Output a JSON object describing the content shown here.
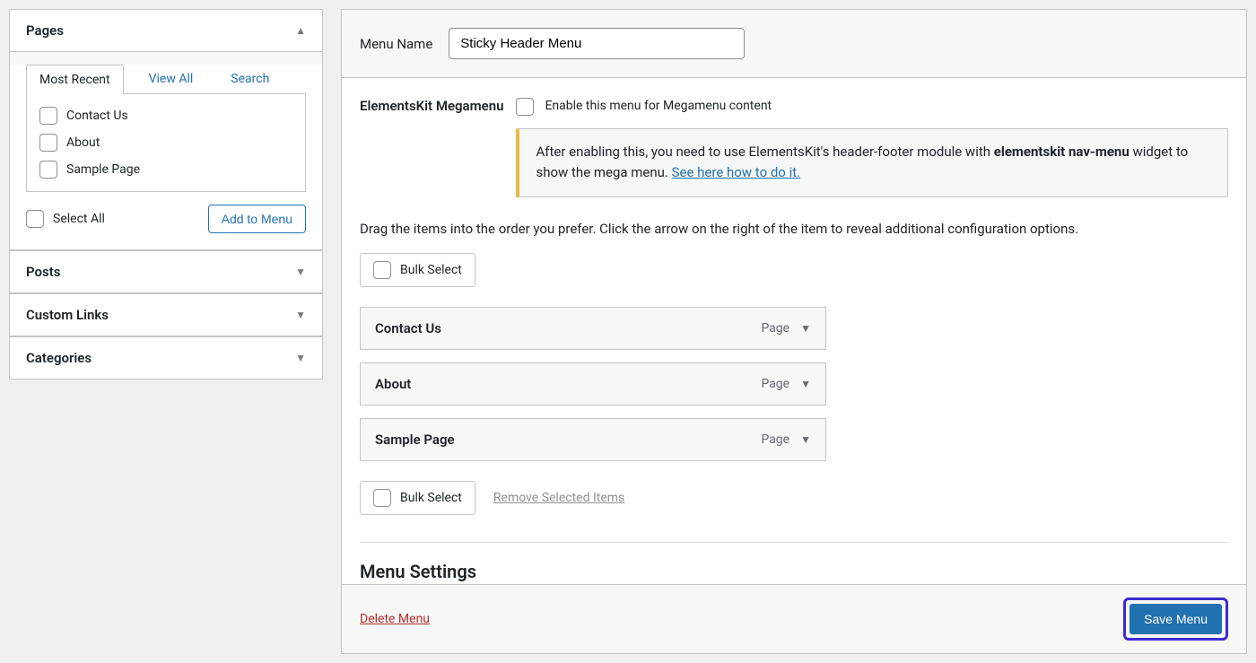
{
  "sidebar": {
    "pages": {
      "title": "Pages",
      "tabs": [
        "Most Recent",
        "View All",
        "Search"
      ],
      "items": [
        "Contact Us",
        "About",
        "Sample Page"
      ],
      "select_all": "Select All",
      "add_to_menu": "Add to Menu"
    },
    "sections": [
      "Posts",
      "Custom Links",
      "Categories"
    ]
  },
  "main": {
    "menu_name_label": "Menu Name",
    "menu_name_value": "Sticky Header Menu",
    "ek_label": "ElementsKit Megamenu",
    "ek_enable": "Enable this menu for Megamenu content",
    "notice_pre": "After enabling this, you need to use ElementsKit's header-footer module with ",
    "notice_bold": "elementskit nav-menu",
    "notice_post": " widget to show the mega menu. ",
    "notice_link": "See here how to do it.",
    "instructions": "Drag the items into the order you prefer. Click the arrow on the right of the item to reveal additional configuration options.",
    "bulk_select": "Bulk Select",
    "menu_items": [
      {
        "title": "Contact Us",
        "type": "Page"
      },
      {
        "title": "About",
        "type": "Page"
      },
      {
        "title": "Sample Page",
        "type": "Page"
      }
    ],
    "remove_selected": "Remove Selected Items",
    "menu_settings": "Menu Settings",
    "delete_menu": "Delete Menu",
    "save_menu": "Save Menu"
  }
}
